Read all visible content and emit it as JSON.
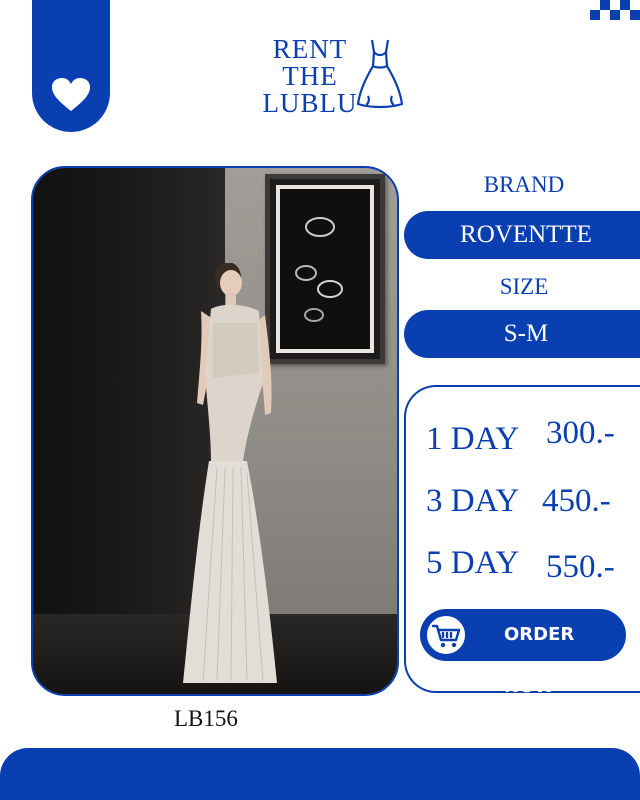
{
  "brand": {
    "name_line1": "RENT",
    "name_line2": "THE",
    "name_line3": "LUBLU"
  },
  "product": {
    "code": "LB156",
    "brand_label": "BRAND",
    "brand_value": "ROVENTTE",
    "size_label": "SIZE",
    "size_value": "S-M"
  },
  "pricing": [
    {
      "duration": "1 DAY",
      "price": "300.-"
    },
    {
      "duration": "3 DAY",
      "price": "450.-"
    },
    {
      "duration": "5 DAY",
      "price": "550.-"
    }
  ],
  "order_button": {
    "label": "ORDER NOW",
    "icon": "shopping-cart-icon"
  },
  "colors": {
    "accent": "#0a3fb1",
    "background": "#ffffff"
  },
  "icons": {
    "favorite": "heart-icon",
    "logo": "dress-icon",
    "corner": "checkered-pattern"
  }
}
